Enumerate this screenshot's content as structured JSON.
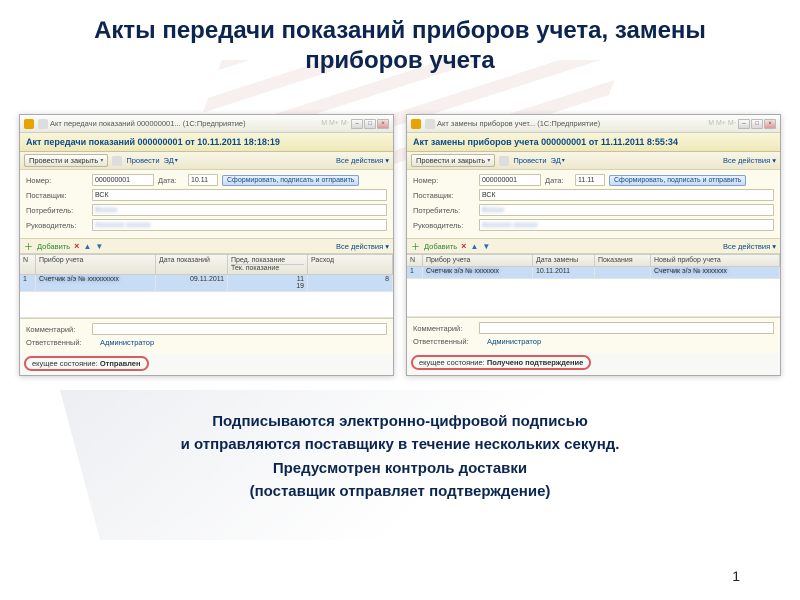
{
  "slide": {
    "title": "Акты передачи показаний приборов учета, замены приборов учета",
    "caption_l1": "Подписываются электронно-цифровой подписью",
    "caption_l2": "и отправляются поставщику в течение нескольких секунд.",
    "caption_l3": "Предусмотрен контроль доставки",
    "caption_l4": "(поставщик отправляет подтверждение)",
    "page": "1"
  },
  "common": {
    "conduct_close": "Провести и закрыть",
    "conduct": "Провести",
    "ed_link": "ЭД",
    "all_actions": "Все действия",
    "add": "Добавить",
    "form_sign_send": "Сформировать, подписать и отправить",
    "lbl_number": "Номер:",
    "lbl_date": "Дата:",
    "lbl_supplier": "Поставщик:",
    "lbl_consumer": "Потребитель:",
    "lbl_manager": "Руководитель:",
    "lbl_comment": "Комментарий:",
    "lbl_responsible": "Ответственный:",
    "responsible_val": "Администратор",
    "status_prefix": "екущее состояние:"
  },
  "win1": {
    "titlebar": "Акт передачи показаний 000000001... (1C:Предприятие)",
    "header": "Акт передачи показаний 000000001 от 10.11.2011 18:18:19",
    "number": "000000001",
    "date": "10.11",
    "supplier": "ВСК",
    "consumer": "Вxxxxx",
    "manager": "Аxxxxxxx xxxxxxx",
    "cols": {
      "n": "N",
      "device": "Прибор учета",
      "read_date": "Дата показаний",
      "prev": "Пред. показание",
      "cur": "Тек. показание",
      "usage": "Расход"
    },
    "row": {
      "n": "1",
      "device": "Счетчик э/э №",
      "date": "09.11.2011",
      "prev": "11",
      "cur": "19",
      "usage": "8"
    },
    "status_val": "Отправлен"
  },
  "win2": {
    "titlebar": "Акт замены приборов учет... (1C:Предприятие)",
    "header": "Акт замены приборов учета 000000001 от 11.11.2011 8:55:34",
    "number": "000000001",
    "date": "11.11",
    "supplier": "ВСК",
    "consumer": "Вxxxxx",
    "manager": "Аxxxxxxx xxxxxxx",
    "cols": {
      "n": "N",
      "device": "Прибор учета",
      "repl_date": "Дата замены",
      "reading": "Показания",
      "new_device": "Новый прибор учета"
    },
    "row": {
      "n": "1",
      "device": "Счетчик э/э №",
      "date": "10.11.2011",
      "reading": "",
      "new_device": "Счетчик э/э №"
    },
    "status_val": "Получено подтверждение"
  }
}
